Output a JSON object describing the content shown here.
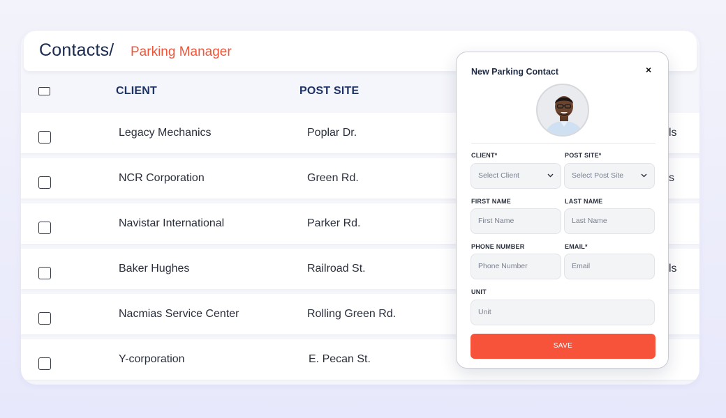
{
  "breadcrumb": {
    "title": "Contacts/",
    "subtitle": "Parking Manager"
  },
  "table": {
    "columns": [
      "CLIENT",
      "POST SITE"
    ],
    "rows": [
      {
        "client": "Legacy Mechanics",
        "post_site": "Poplar Dr.",
        "extra": "ls"
      },
      {
        "client": "NCR Corporation",
        "post_site": "Green Rd.",
        "extra": "s"
      },
      {
        "client": "Navistar International",
        "post_site": "Parker Rd.",
        "extra": ""
      },
      {
        "client": "Baker Hughes",
        "post_site": "Railroad St.",
        "extra": "ls"
      },
      {
        "client": "Nacmias Service Center",
        "post_site": "Rolling Green Rd.",
        "extra": ""
      },
      {
        "client": "Y-corporation",
        "post_site": "E. Pecan St.",
        "extra": ""
      }
    ]
  },
  "modal": {
    "title": "New Parking Contact",
    "close": "×",
    "client_label": "CLIENT*",
    "client_value": "Select Client",
    "post_site_label": "POST SITE*",
    "post_site_value": "Select Post Site",
    "first_name_label": "FIRST NAME",
    "first_name_placeholder": "First Name",
    "last_name_label": "LAST NAME",
    "last_name_placeholder": "Last Name",
    "phone_label": "PHONE NUMBER",
    "phone_placeholder": "Phone Number",
    "email_label": "EMAIL*",
    "email_placeholder": "Email",
    "unit_label": "UNIT",
    "unit_placeholder": "Unit",
    "save_label": "SAVE"
  },
  "colors": {
    "accent": "#f7533b",
    "navy": "#1d3266"
  },
  "icons": {
    "close": "close-icon",
    "dropdown": "chevron-down-icon",
    "avatar": "avatar"
  }
}
